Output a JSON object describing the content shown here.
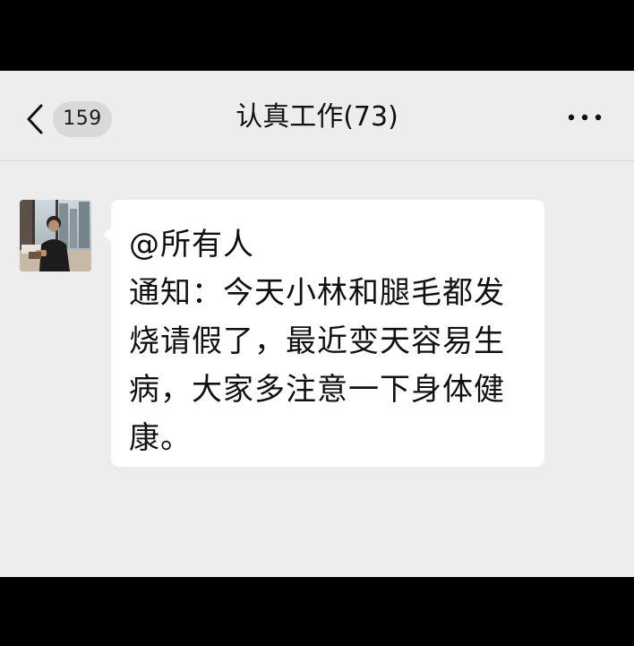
{
  "navbar": {
    "back_icon": "chevron-left-icon",
    "unread_count": "159",
    "title": "认真工作(73)",
    "more_icon": "ellipsis-icon"
  },
  "message": {
    "sender_avatar": "avatar",
    "mention": "@所有人",
    "body_lines": [
      "通知：今天小林和腿毛都发",
      "烧请假了，最近变天容易生",
      "病，大家多注意一下身体健",
      "康。"
    ]
  },
  "colors": {
    "background": "#ededed",
    "bubble": "#ffffff",
    "badge": "#d9d9d9",
    "letterbox": "#000000"
  }
}
